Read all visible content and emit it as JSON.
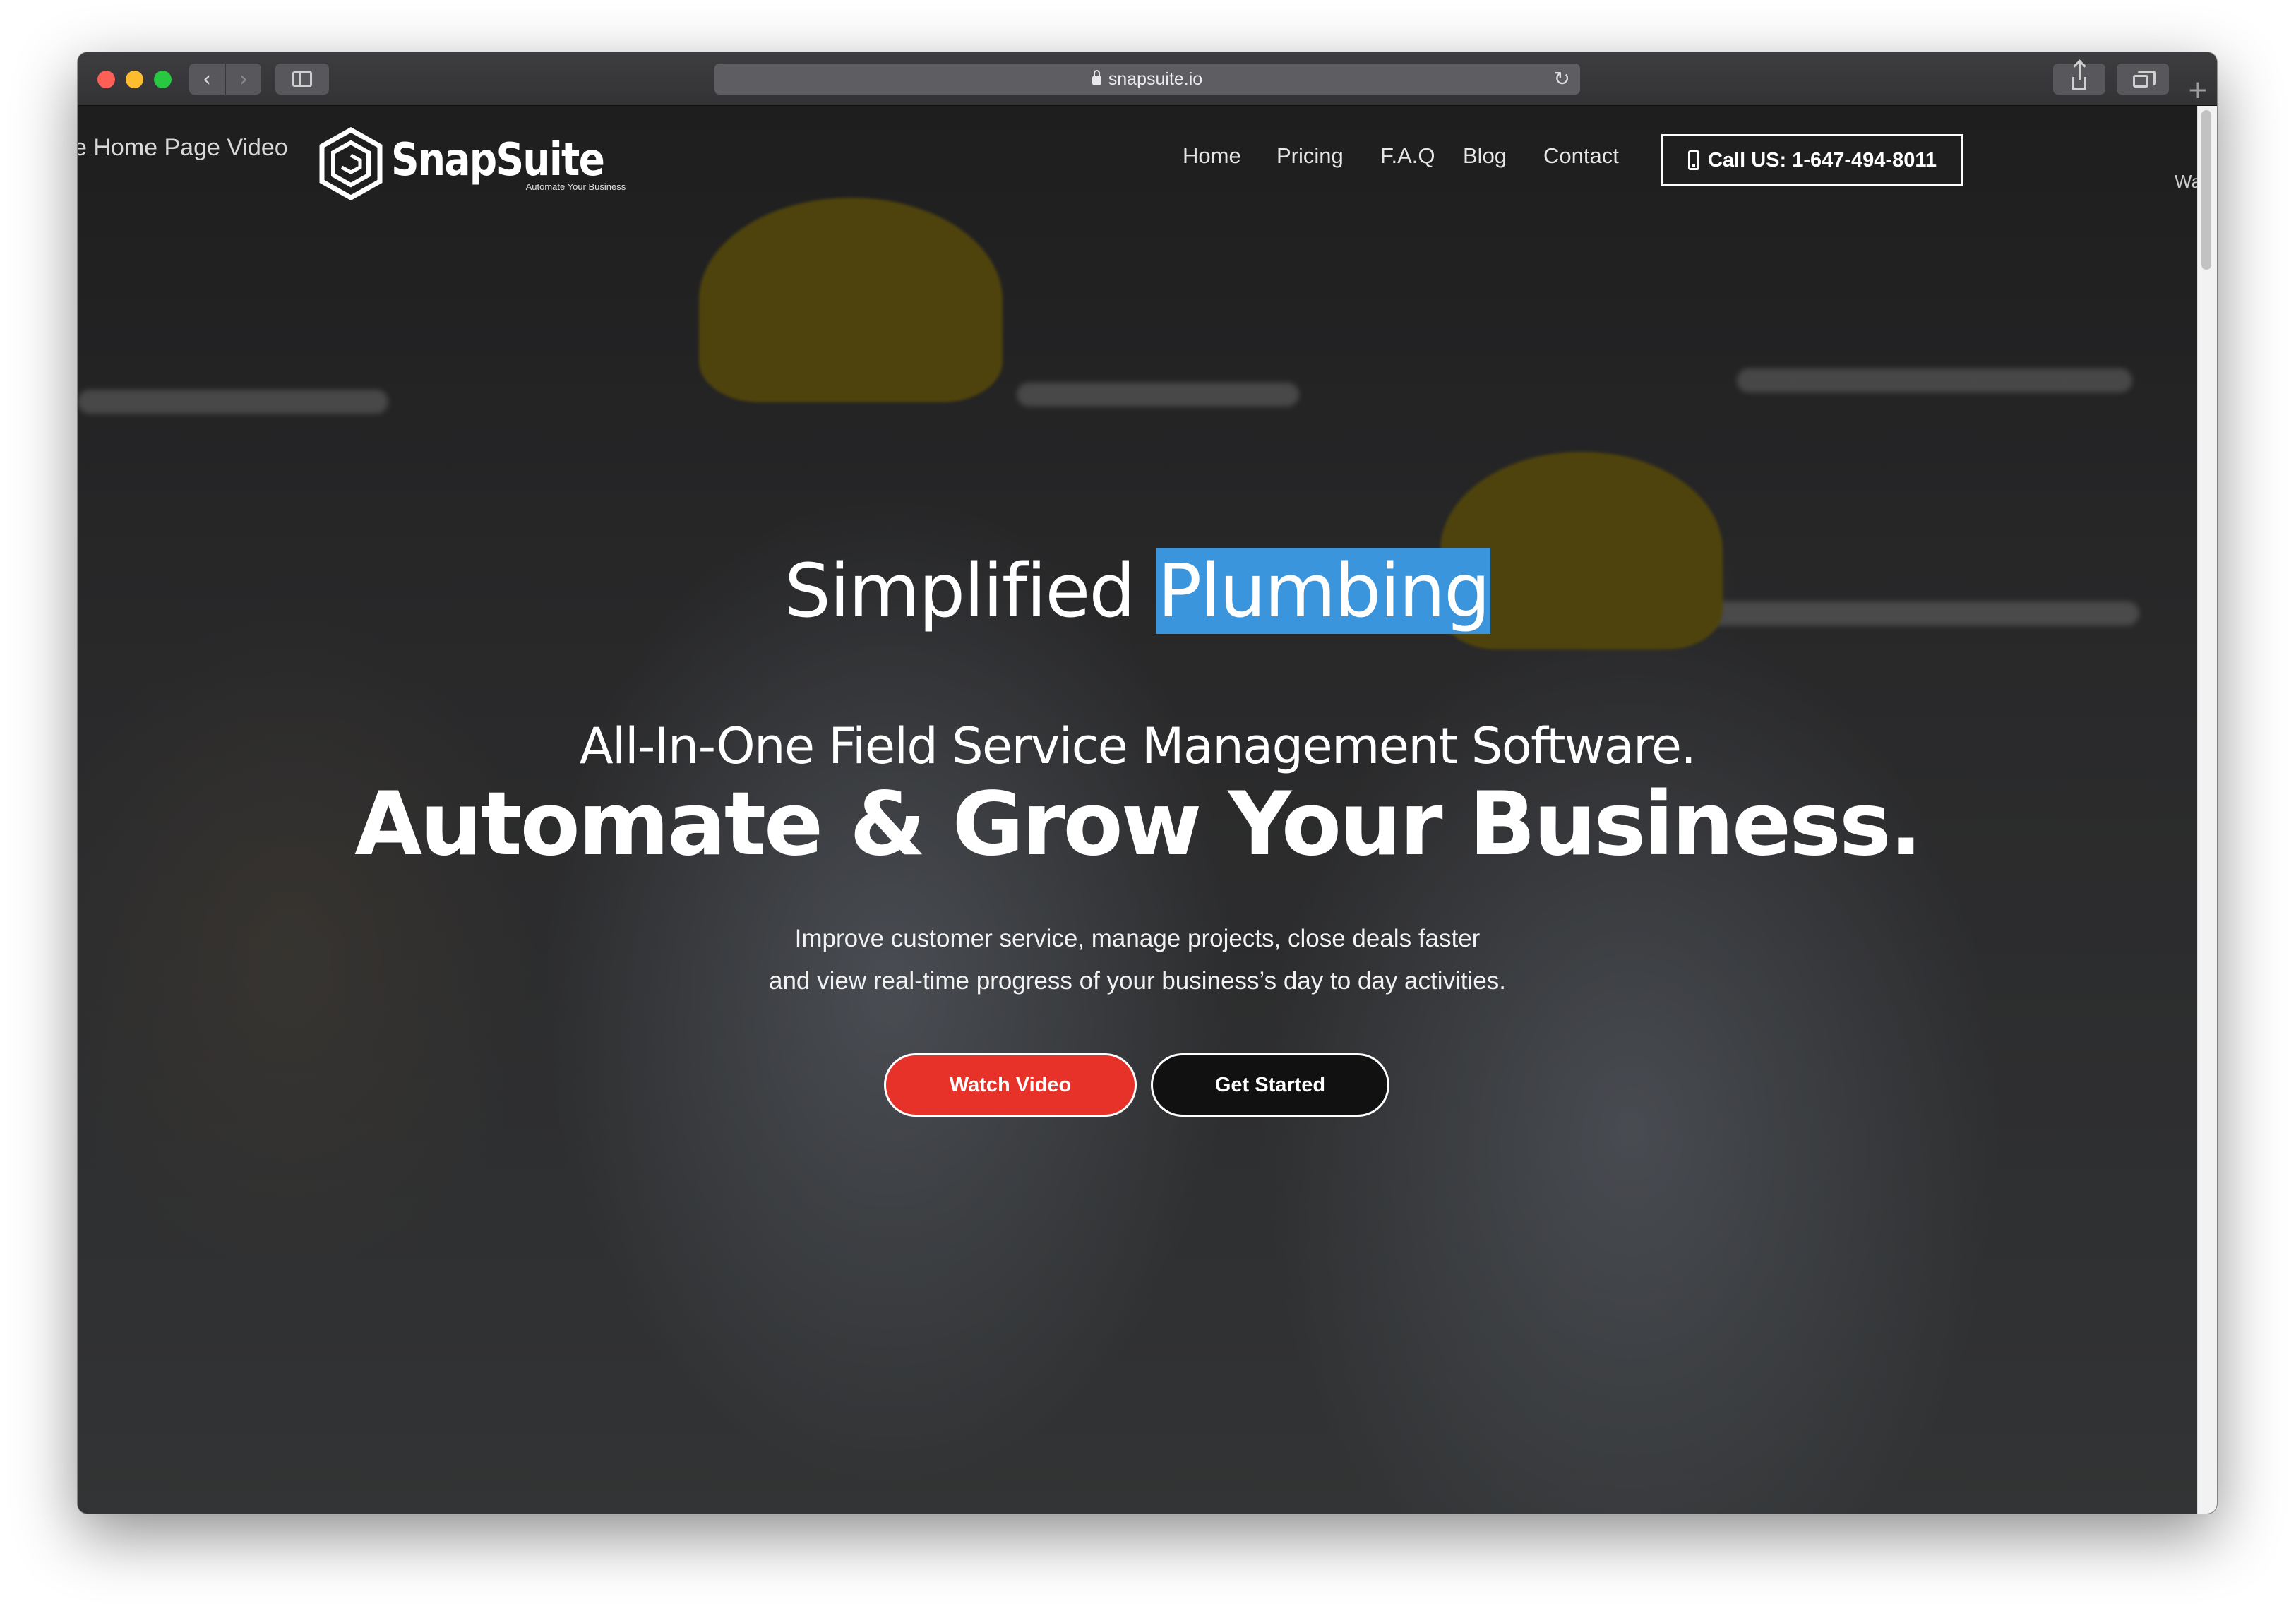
{
  "browser": {
    "url": "snapsuite.io",
    "icons": {
      "back": "chevron-left-icon",
      "forward": "chevron-right-icon",
      "sidebar": "sidebar-icon",
      "lock": "lock-icon",
      "reload": "reload-icon",
      "share": "share-icon",
      "tabs": "tabs-icon",
      "new_tab": "plus-icon"
    },
    "back_glyph": "‹",
    "forward_glyph": "›",
    "reload_glyph": "↻",
    "new_tab_glyph": "+"
  },
  "header": {
    "video_label": "e Home Page Video",
    "logo": {
      "name": "SnapSuite",
      "tagline": "Automate Your Business"
    },
    "nav": [
      "Home",
      "Pricing",
      "F.A.Q",
      "Blog",
      "Contact"
    ],
    "call_button": "Call US: 1-647-494-8011",
    "edge_text": "Wa"
  },
  "hero": {
    "line1_prefix": "Simplified",
    "line1_highlight": "Plumbing",
    "subtitle": "All-In-One Field Service Management Software.",
    "headline": "Automate & Grow Your Business.",
    "description_line1": "Improve customer service, manage projects, close deals faster",
    "description_line2": "and view real-time progress of your business’s day to day activities.",
    "watch_button": "Watch Video",
    "start_button": "Get Started"
  },
  "colors": {
    "highlight": "#3a95dc",
    "watch_button": "#e63228",
    "start_button": "#111111"
  }
}
